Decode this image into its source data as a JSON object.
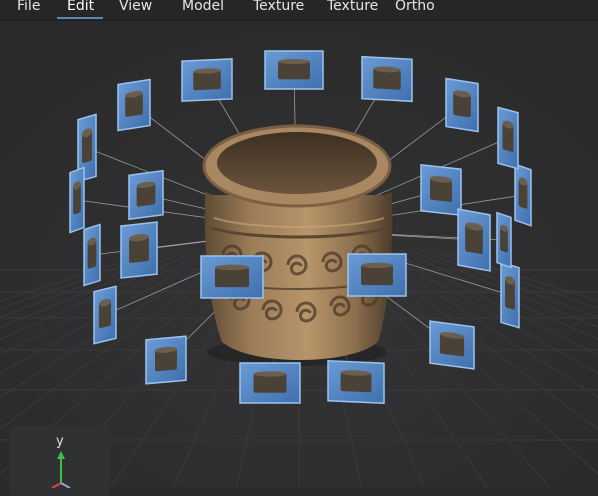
{
  "menu": {
    "items": [
      "File",
      "Edit",
      "View",
      "Model",
      "Texture",
      "Texture",
      "Ortho"
    ],
    "active": "Edit"
  },
  "viewport": {
    "object": "carved-stone-pot-model",
    "camera_count": 30
  },
  "gizmo": {
    "y_label": "y"
  },
  "colors": {
    "background": "#2b2b2c",
    "menubar": "#262627",
    "camera_frame": "#4f83c2",
    "accent": "#5e86b3",
    "gizmo_y_axis": "#3cc04a",
    "gizmo_x_axis": "#e0433f"
  }
}
